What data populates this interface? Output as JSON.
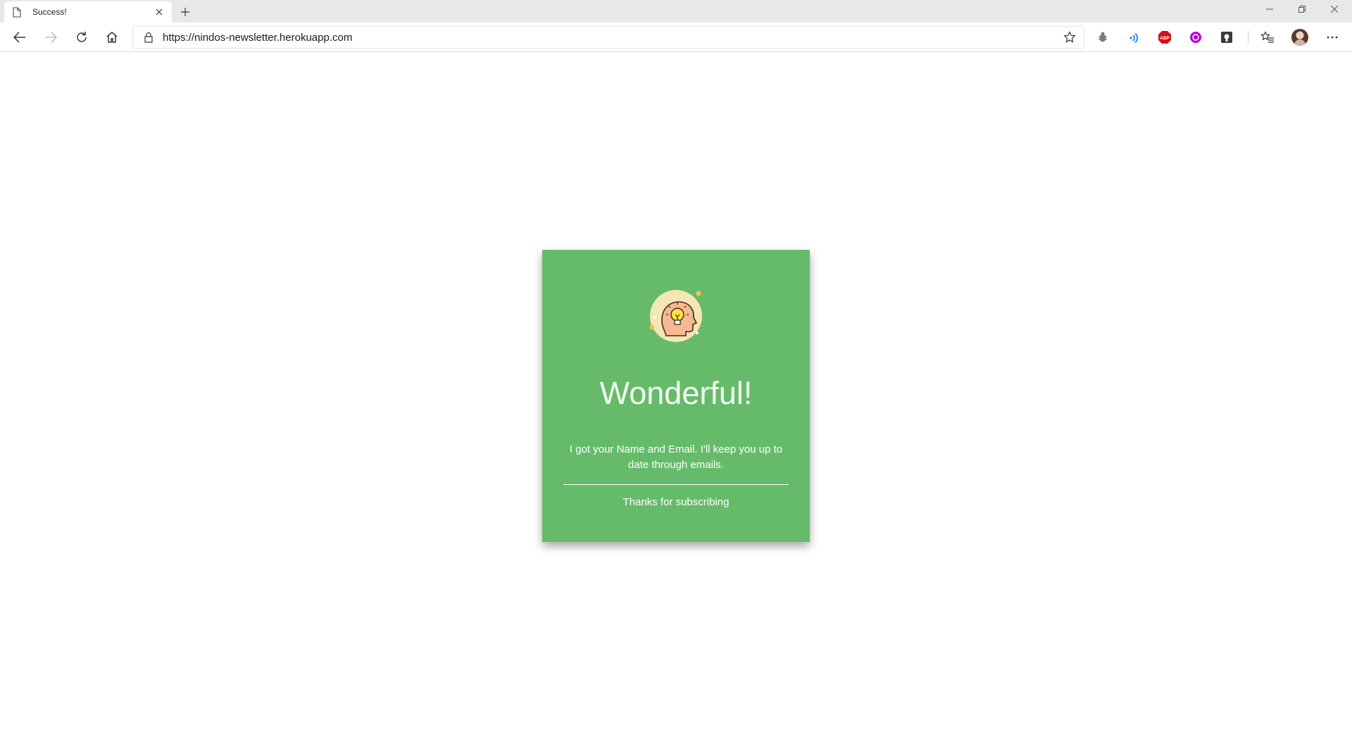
{
  "browser": {
    "tab": {
      "title": "Success!",
      "icon": "document-icon"
    },
    "address": {
      "url": "https://nindos-newsletter.herokuapp.com"
    },
    "extensions": [
      {
        "name": "bug-extension-icon",
        "color": "#7a7a7a"
      },
      {
        "name": "readaloud-extension-icon",
        "color": "#1e90ff"
      },
      {
        "name": "adblock-plus-extension-icon",
        "color": "#d0121b",
        "label": "ABP"
      },
      {
        "name": "purple-extension-icon",
        "color": "#b400d8"
      },
      {
        "name": "dark-extension-icon",
        "color": "#3a3a3a"
      }
    ]
  },
  "page": {
    "title": "Wonderful!",
    "message": "I got your Name and Email. I'll keep you up to date through emails.",
    "footer": "Thanks for subscribing",
    "card_color": "#66bb6a",
    "illustration": "head-lightbulb-icon"
  }
}
